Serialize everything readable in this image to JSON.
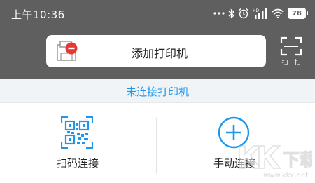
{
  "status_bar": {
    "time": "上午10:36",
    "icons": [
      "more-dots-icon",
      "bluetooth-icon",
      "alarm-icon",
      "hd-signal-icon",
      "wifi-icon",
      "battery-icon"
    ],
    "hd_label": "HD",
    "battery_level": "78"
  },
  "header": {
    "add_printer_label": "添加打印机",
    "scan_label": "扫一扫"
  },
  "connection": {
    "status_text": "未连接打印机"
  },
  "actions": {
    "scan_connect_label": "扫码连接",
    "manual_connect_label": "手动连接"
  },
  "watermark": {
    "logo_text": "K下载",
    "url": "www.kkx.net"
  },
  "colors": {
    "header_bg": "#5f5f5f",
    "accent_blue": "#2196e8",
    "printer_red": "#e53935",
    "strip_bg": "#f1f4f6"
  }
}
